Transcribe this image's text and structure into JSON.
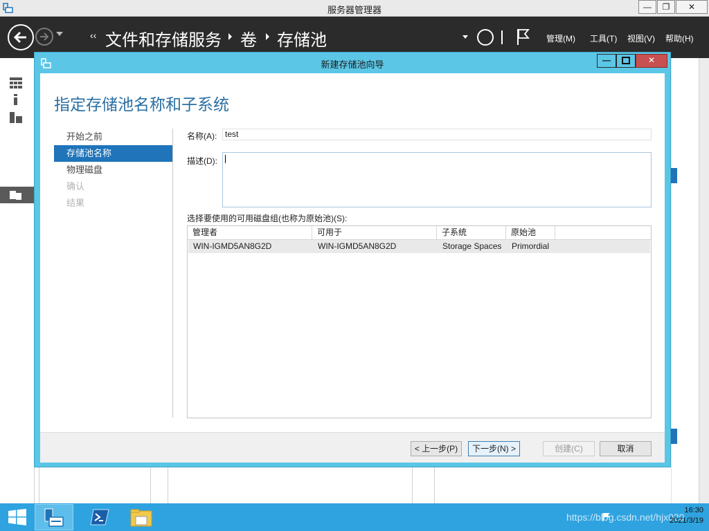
{
  "window": {
    "title": "服务器管理器",
    "min_glyph": "—",
    "max_glyph": "❐",
    "close_glyph": "✕"
  },
  "header": {
    "breadcrumb_prefix": "‹‹",
    "breadcrumb": [
      "文件和存储服务",
      "卷",
      "存储池"
    ],
    "menu": [
      "管理(M)",
      "工具(T)",
      "视图(V)",
      "帮助(H)"
    ]
  },
  "dialog": {
    "title": "新建存储池向导",
    "heading": "指定存储池名称和子系统",
    "steps": [
      {
        "label": "开始之前",
        "state": "normal"
      },
      {
        "label": "存储池名称",
        "state": "active"
      },
      {
        "label": "物理磁盘",
        "state": "normal"
      },
      {
        "label": "确认",
        "state": "disabled"
      },
      {
        "label": "结果",
        "state": "disabled"
      }
    ],
    "name_label": "名称(A):",
    "name_value": "test",
    "desc_label": "描述(D):",
    "desc_value": "",
    "group_label": "选择要使用的可用磁盘组(也称为原始池)(S):",
    "grid": {
      "columns": [
        "管理者",
        "可用于",
        "子系统",
        "原始池"
      ],
      "rows": [
        [
          "WIN-IGMD5AN8G2D",
          "WIN-IGMD5AN8G2D",
          "Storage Spaces",
          "Primordial"
        ]
      ]
    },
    "buttons": {
      "prev": "< 上一步(P)",
      "next": "下一步(N) >",
      "create": "创建(C)",
      "cancel": "取消"
    }
  },
  "taskbar": {
    "time": "16:30",
    "date": "2021/3/19",
    "watermark": "https://blog.csdn.net/hjx020"
  },
  "colors": {
    "dialog_frame": "#5bc6e6",
    "heading": "#2a6fa3",
    "active_step": "#1f74ba",
    "header_bg": "#2b2b2b",
    "taskbar": "#2fa3e0"
  }
}
